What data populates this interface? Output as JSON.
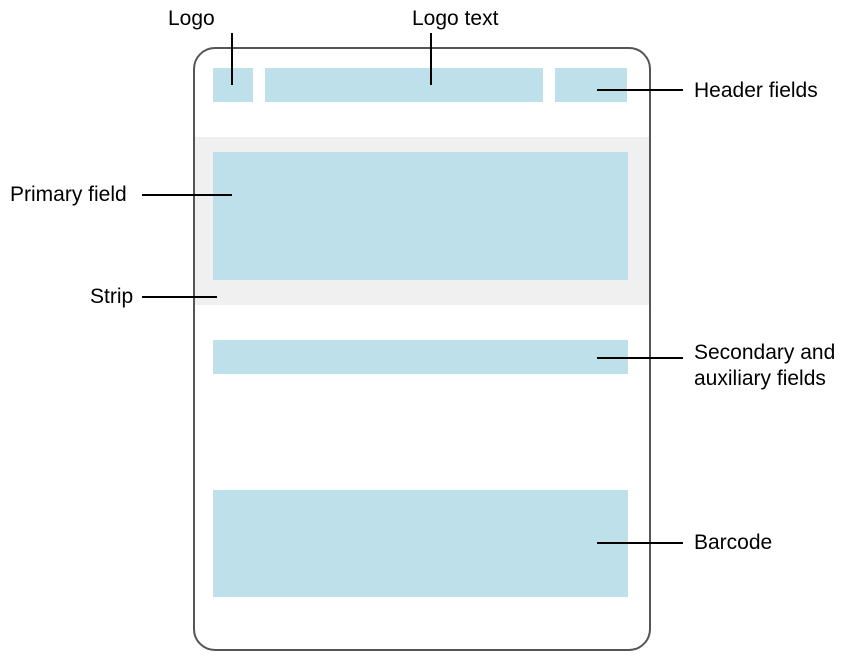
{
  "labels": {
    "logo": "Logo",
    "logo_text": "Logo text",
    "header_fields": "Header fields",
    "primary_field": "Primary field",
    "strip": "Strip",
    "secondary_auxiliary": "Secondary and\nauxiliary fields",
    "barcode": "Barcode"
  },
  "colors": {
    "region_fill": "#bde0eb",
    "strip_fill": "#f0f0f0",
    "card_border": "#555"
  },
  "layout": {
    "type": "pass-coupon-wireframe",
    "regions": [
      "logo",
      "logo_text",
      "header_fields",
      "strip",
      "primary_field",
      "secondary_auxiliary",
      "barcode"
    ]
  }
}
